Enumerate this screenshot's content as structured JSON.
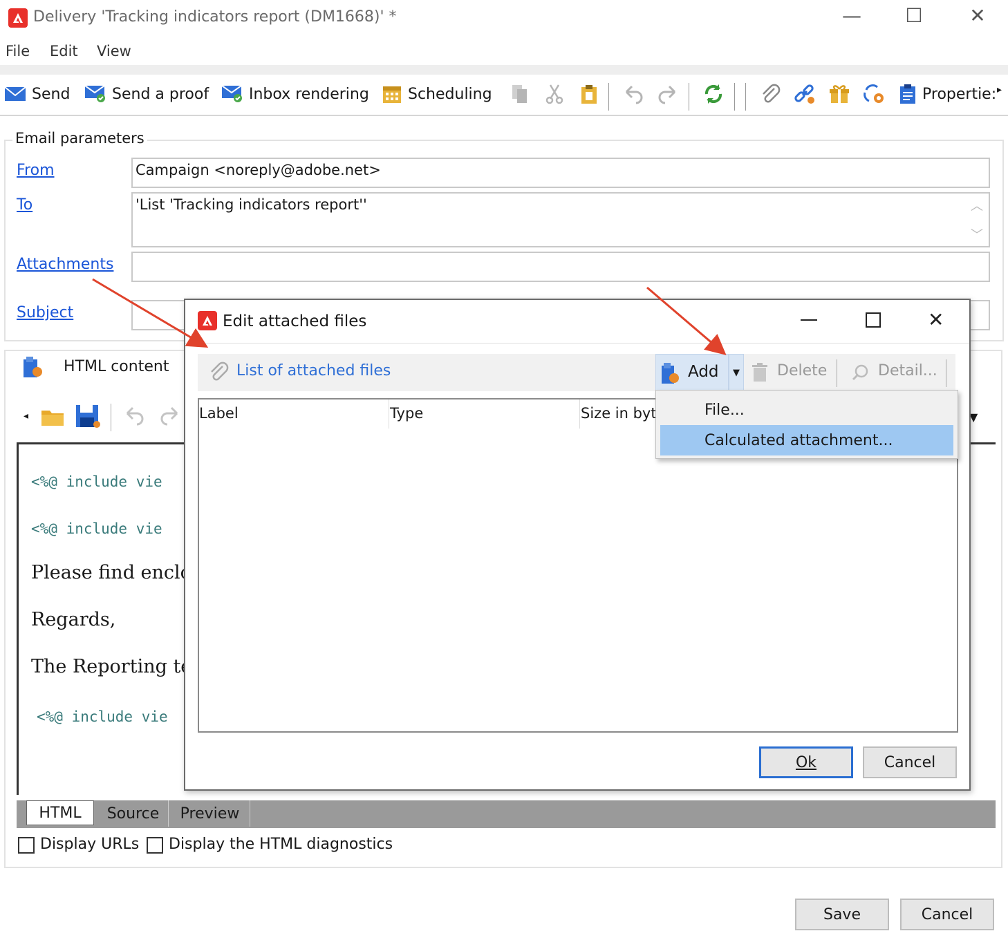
{
  "window": {
    "title": "Delivery 'Tracking indicators report (DM1668)' *",
    "controls": {
      "minimize": "—",
      "maximize": "☐",
      "close": "✕"
    }
  },
  "menu": {
    "file": "File",
    "edit": "Edit",
    "view": "View"
  },
  "toolbar": {
    "send": "Send",
    "send_proof": "Send a proof",
    "inbox_rendering": "Inbox rendering",
    "scheduling": "Scheduling",
    "properties": "Propertie:"
  },
  "email_params": {
    "legend": "Email parameters",
    "from_label": "From",
    "from_value": "Campaign <noreply@adobe.net>",
    "to_label": "To",
    "to_value": "'List 'Tracking indicators report''",
    "attachments_label": "Attachments",
    "attachments_value": "",
    "subject_label": "Subject",
    "subject_value": ""
  },
  "content": {
    "header": "HTML content",
    "lines": {
      "l1": "<%@ include vie",
      "l2": "<%@ include vie",
      "l3": "Please find enclo",
      "l4": "Regards,",
      "l5": "The Reporting tea",
      "l6": "<%@ include vie"
    },
    "tabs": {
      "html": "HTML",
      "source": "Source",
      "preview": "Preview"
    },
    "display_urls": "Display URLs",
    "display_diagnostics": "Display the HTML diagnostics"
  },
  "dialog": {
    "title": "Edit attached files",
    "list_label": "List of attached files",
    "add": "Add",
    "delete": "Delete",
    "detail": "Detail...",
    "columns": {
      "label": "Label",
      "type": "Type",
      "size": "Size in byt"
    },
    "menu": {
      "file": "File...",
      "calculated": "Calculated attachment..."
    },
    "ok": "Ok",
    "cancel": "Cancel"
  },
  "footer": {
    "save": "Save",
    "cancel": "Cancel"
  },
  "colors": {
    "accent": "#1a55d8",
    "brand_red": "#e8302a",
    "selection": "#9ec8f2",
    "arrow": "#e0432c"
  }
}
